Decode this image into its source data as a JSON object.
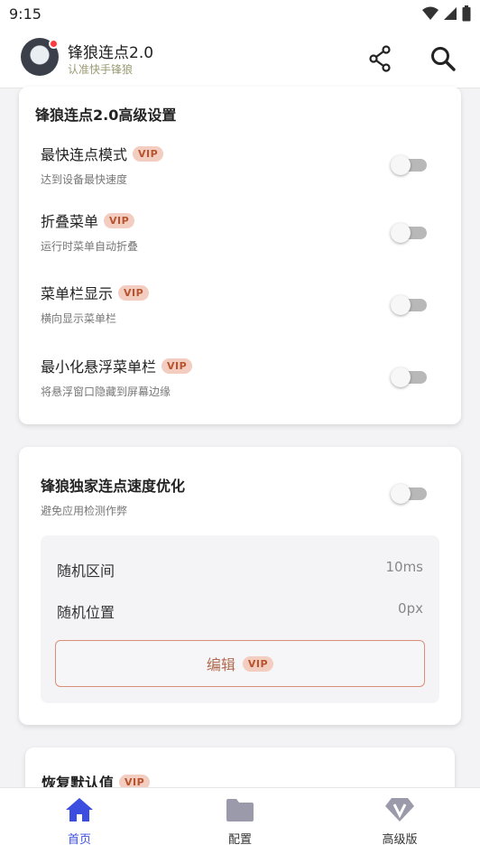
{
  "status": {
    "time": "9:15"
  },
  "header": {
    "title": "锋狼连点2.0",
    "subtitle": "认准快手锋狼"
  },
  "advanced": {
    "title": "锋狼连点2.0高级设置",
    "items": [
      {
        "label": "最快连点模式",
        "badge": "VIP",
        "desc": "达到设备最快速度",
        "enabled": false
      },
      {
        "label": "折叠菜单",
        "badge": "VIP",
        "desc": "运行时菜单自动折叠",
        "enabled": false
      },
      {
        "label": "菜单栏显示",
        "badge": "VIP",
        "desc": "横向显示菜单栏",
        "enabled": false
      },
      {
        "label": "最小化悬浮菜单栏",
        "badge": "VIP",
        "desc": "将悬浮窗口隐藏到屏幕边缘",
        "enabled": false
      }
    ]
  },
  "speed": {
    "title": "锋狼独家连点速度优化",
    "desc": "避免应用检测作弊",
    "enabled": false,
    "rows": [
      {
        "label": "随机区间",
        "value": "10ms"
      },
      {
        "label": "随机位置",
        "value": "0px"
      }
    ],
    "edit_label": "编辑",
    "edit_badge": "VIP"
  },
  "reset": {
    "title": "恢复默认值",
    "badge": "VIP"
  },
  "nav": {
    "items": [
      {
        "label": "首页",
        "icon": "home-icon",
        "active": true
      },
      {
        "label": "配置",
        "icon": "folder-icon",
        "active": false
      },
      {
        "label": "高级版",
        "icon": "diamond-icon",
        "active": false
      }
    ]
  },
  "colors": {
    "accent": "#3c4ee0",
    "vip_bg": "#f3cdbf",
    "vip_text": "#b7532e",
    "subtitle": "#9a9a72"
  }
}
